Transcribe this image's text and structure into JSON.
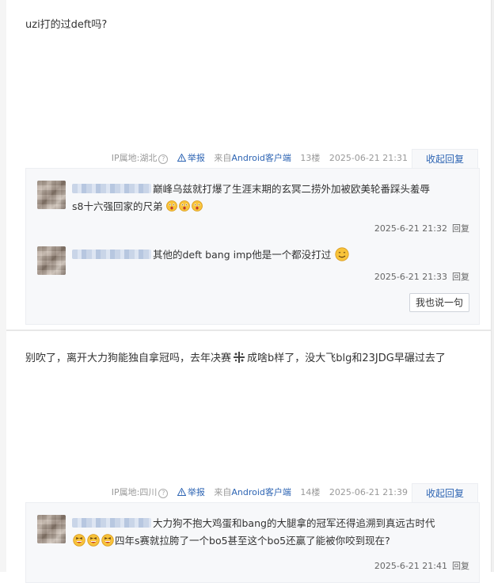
{
  "post1": {
    "body": "uzi打的过deft吗?",
    "meta": {
      "ip_label": "IP属地:湖北",
      "help_symbol": "?",
      "report_label": "举报",
      "app_prefix": "来自",
      "app_name": "Android客户端",
      "floor": "13楼",
      "time": "2025-06-21 21:31"
    },
    "collapse_label": "收起回复",
    "replies": [
      {
        "text_line1": "巅峰乌兹就打爆了生涯末期的玄冥二捞外加被欧美轮番踩头羞辱",
        "text_line2": "s8十六强回家的尺弟",
        "emoji_name": "surprised-face-emoji",
        "time": "2025-6-21 21:32",
        "reply_label": "回复"
      },
      {
        "text": "其他的deft bang imp他是一个都没打过",
        "emoji_name": "smile-face-emoji",
        "time": "2025-6-21 21:33",
        "reply_label": "回复"
      }
    ],
    "say_button": "我也说一句"
  },
  "post2": {
    "body_part1": "别吹了，离开大力狗能独自拿冠吗，去年决赛",
    "body_part2": "成啥b样了，没大飞blg和23JDG早碾过去了",
    "inline_icon": "cross-dots-icon",
    "meta": {
      "ip_label": "IP属地:四川",
      "help_symbol": "?",
      "report_label": "举报",
      "app_prefix": "来自",
      "app_name": "Android客户端",
      "floor": "14楼",
      "time": "2025-06-21 21:39"
    },
    "collapse_label": "收起回复",
    "replies": [
      {
        "text_line1": "大力狗不抱大鸡蛋和bang的大腿拿的冠军还得追溯到真远古时代",
        "text_line2": "四年s赛就拉胯了一个bo5甚至这个bo5还赢了能被你咬到现在?",
        "emoji_name": "laughing-face-emoji",
        "time": "2025-6-21 21:41",
        "reply_label": "回复"
      }
    ]
  },
  "colors": {
    "link_blue": "#2d64b3",
    "reply_bg": "#f7f8fa",
    "meta_gray": "#999999"
  }
}
